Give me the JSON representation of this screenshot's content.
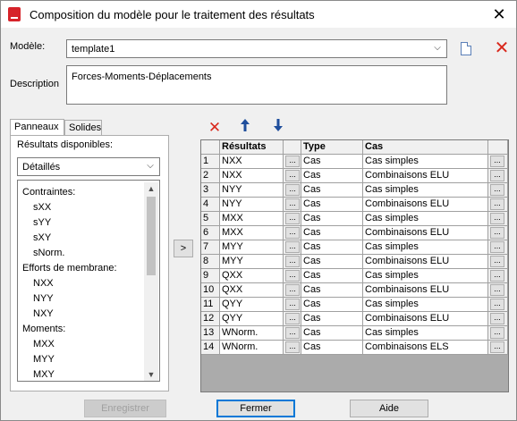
{
  "window": {
    "title": "Composition du modèle pour le traitement des résultats"
  },
  "model": {
    "label": "Modèle:",
    "value": "template1"
  },
  "description": {
    "label": "Description",
    "value": "Forces-Moments-Déplacements"
  },
  "tabs": [
    {
      "label": "Panneaux"
    },
    {
      "label": "Solides"
    }
  ],
  "available": {
    "label": "Résultats disponibles:",
    "filter": "Détaillés",
    "items": [
      "Contraintes:",
      "sXX",
      "sYY",
      "sXY",
      "sNorm.",
      "Efforts de membrane:",
      "NXX",
      "NYY",
      "NXY",
      "Moments:",
      "MXX",
      "MYY",
      "MXY"
    ]
  },
  "move_button": ">",
  "grid": {
    "headers": [
      "Résultats",
      "Type",
      "Cas"
    ],
    "rows": [
      {
        "n": "1",
        "result": "NXX",
        "type": "Cas",
        "case": "Cas simples"
      },
      {
        "n": "2",
        "result": "NXX",
        "type": "Cas",
        "case": "Combinaisons ELU"
      },
      {
        "n": "3",
        "result": "NYY",
        "type": "Cas",
        "case": "Cas simples"
      },
      {
        "n": "4",
        "result": "NYY",
        "type": "Cas",
        "case": "Combinaisons ELU"
      },
      {
        "n": "5",
        "result": "MXX",
        "type": "Cas",
        "case": "Cas simples"
      },
      {
        "n": "6",
        "result": "MXX",
        "type": "Cas",
        "case": "Combinaisons ELU"
      },
      {
        "n": "7",
        "result": "MYY",
        "type": "Cas",
        "case": "Cas simples"
      },
      {
        "n": "8",
        "result": "MYY",
        "type": "Cas",
        "case": "Combinaisons ELU"
      },
      {
        "n": "9",
        "result": "QXX",
        "type": "Cas",
        "case": "Cas simples"
      },
      {
        "n": "10",
        "result": "QXX",
        "type": "Cas",
        "case": "Combinaisons ELU"
      },
      {
        "n": "11",
        "result": "QYY",
        "type": "Cas",
        "case": "Cas simples"
      },
      {
        "n": "12",
        "result": "QYY",
        "type": "Cas",
        "case": "Combinaisons ELU"
      },
      {
        "n": "13",
        "result": "WNorm.",
        "type": "Cas",
        "case": "Cas simples"
      },
      {
        "n": "14",
        "result": "WNorm.",
        "type": "Cas",
        "case": "Combinaisons ELS"
      }
    ],
    "ellipsis": "..."
  },
  "buttons": {
    "save": "Enregistrer",
    "close": "Fermer",
    "help": "Aide"
  },
  "icons": {
    "delete": "delete-icon",
    "up": "arrow-up-icon",
    "down": "arrow-down-icon"
  },
  "colors": {
    "accent": "#0078d7",
    "delete_red": "#d9281c",
    "arrow_blue": "#1f4e9c"
  }
}
